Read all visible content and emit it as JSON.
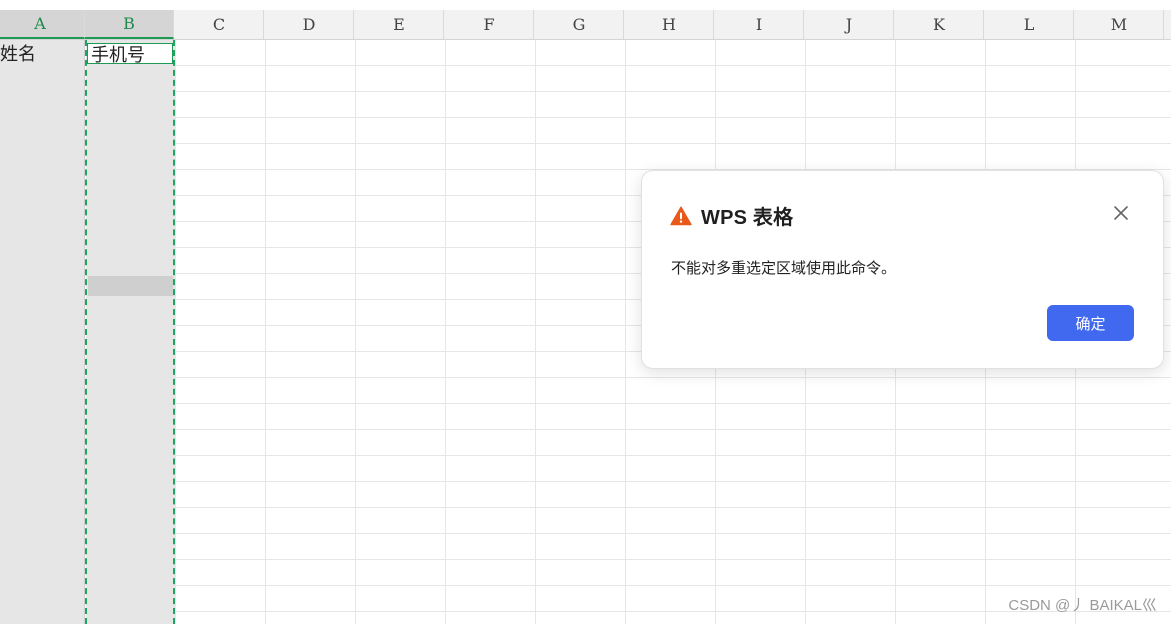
{
  "columns": [
    "A",
    "B",
    "C",
    "D",
    "E",
    "F",
    "G",
    "H",
    "I",
    "J",
    "K",
    "L",
    "M"
  ],
  "cells": {
    "A1": "姓名",
    "B1": "手机号"
  },
  "dialog": {
    "title": "WPS 表格",
    "message": "不能对多重选定区域使用此命令。",
    "ok_label": "确定",
    "icon": "warning-icon",
    "accent_color": "#4169f0",
    "warning_color": "#e8591a"
  },
  "watermark": "CSDN @丿 BAIKAL巛",
  "selection_color": "#1fa462"
}
